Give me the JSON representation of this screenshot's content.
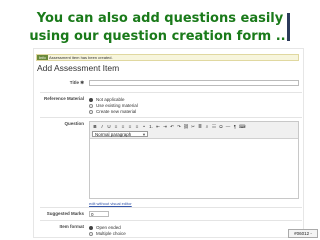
{
  "slide": {
    "title_line1": "You can also add questions easily",
    "title_line2": "using our question creation form ...",
    "number": "#06012 -"
  },
  "info_message": {
    "tag": "Info",
    "text": "Assessment item has been created."
  },
  "form": {
    "heading": "Add Assessment Item",
    "title_label": "Title ✱",
    "title_value": "",
    "reference_label": "Reference Material",
    "reference_options": [
      "Not applicable",
      "Use existing material",
      "Create new material"
    ],
    "reference_selected": 0,
    "question_label": "Question",
    "editor": {
      "toolbar_buttons": [
        "B",
        "I",
        "U",
        "≡",
        "≡",
        "≡",
        "≡",
        "•",
        "1.",
        "⇤",
        "⇥",
        "↶",
        "↷",
        "⛓",
        "✂",
        "≣",
        "⌕",
        "☷",
        "Ω",
        "—",
        "¶",
        "⌨"
      ],
      "format_select": "Normal paragraph"
    },
    "edit_link": "edit without visual editor",
    "marks_label": "Suggested Marks",
    "marks_value": "0",
    "item_format_label": "Item format",
    "item_format_options": [
      "Open ended",
      "Multiple choice"
    ],
    "item_format_selected": 0
  }
}
